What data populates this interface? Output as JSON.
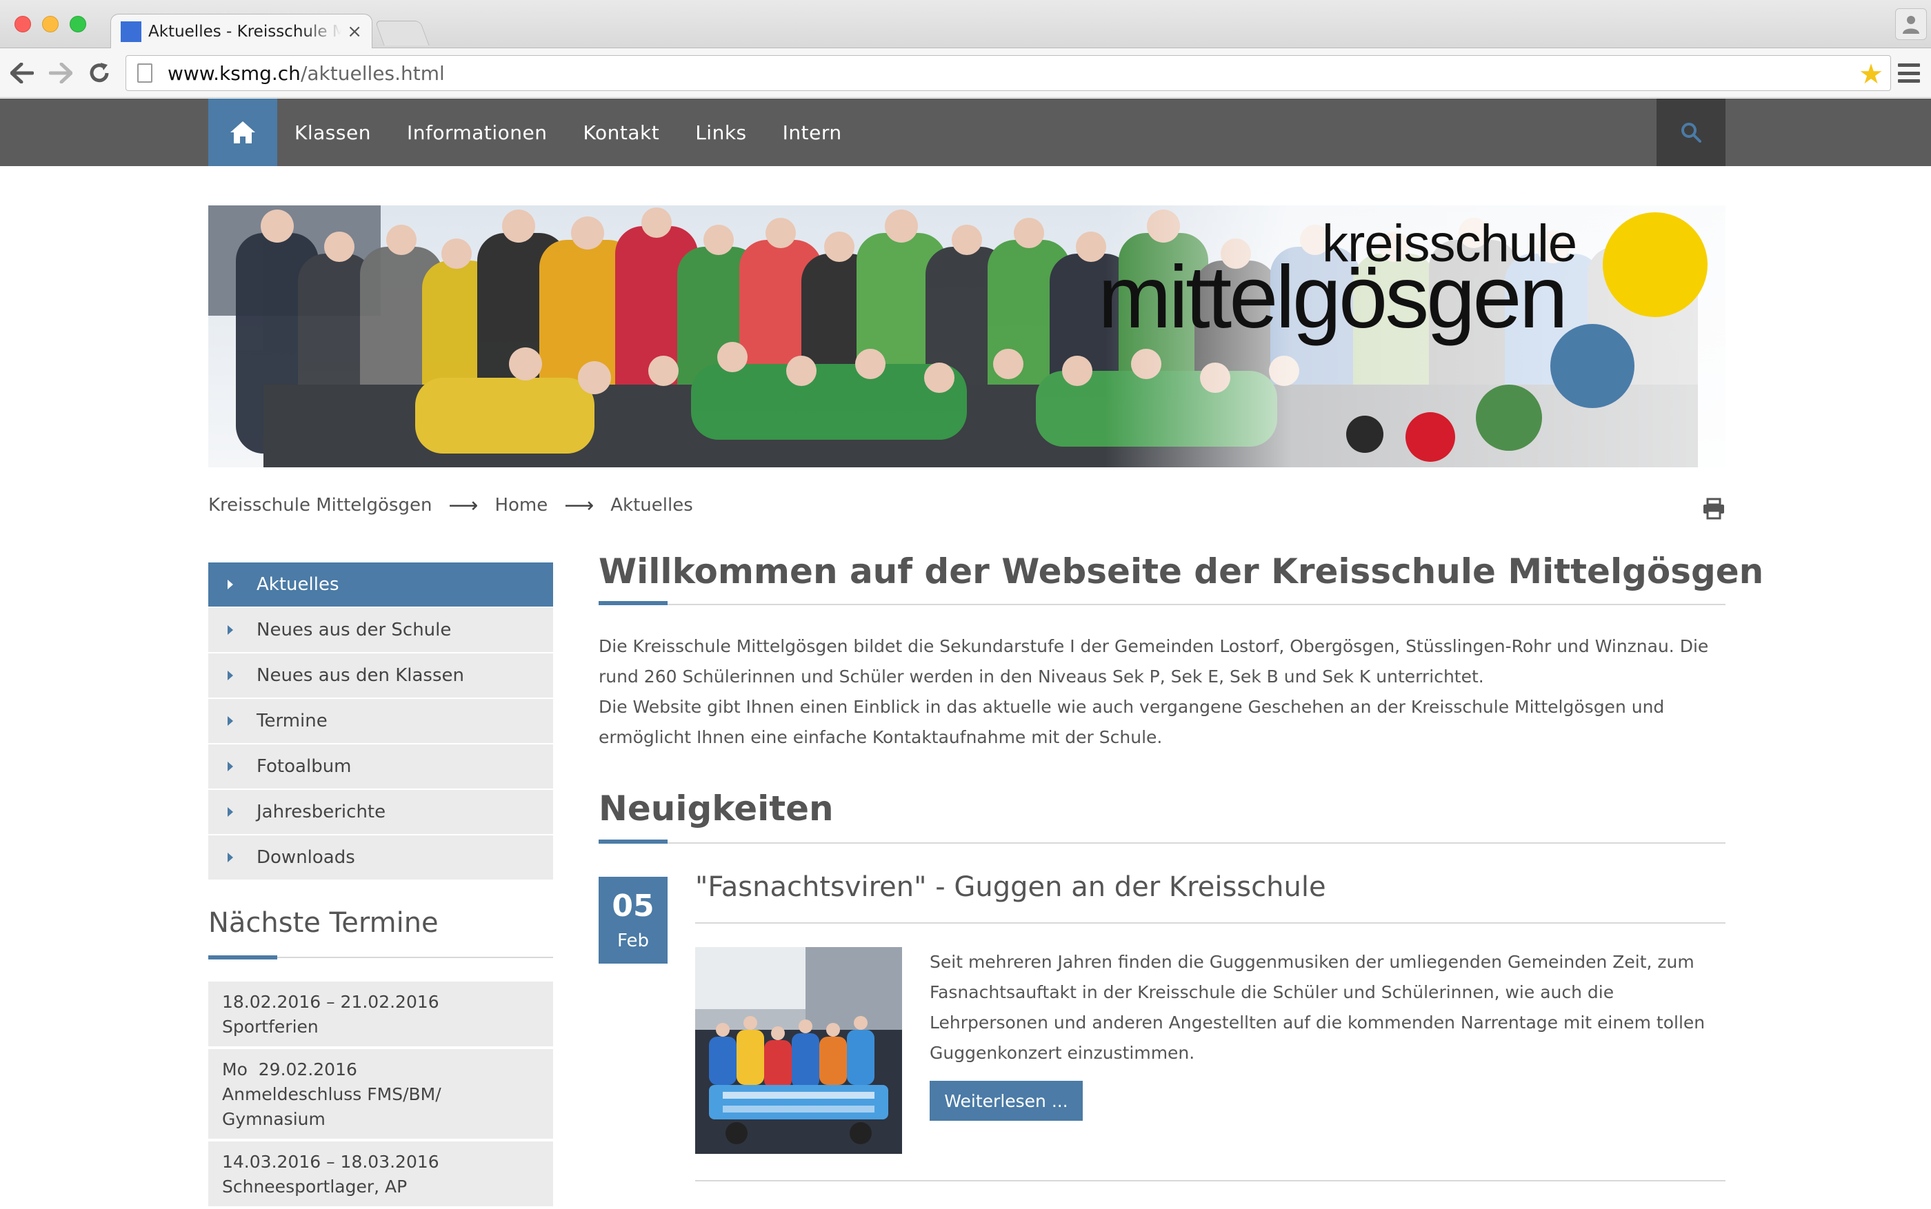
{
  "browser": {
    "tab_title": "Aktuelles - Kreisschule Mittelgösgen",
    "tab_close": "×",
    "url_domain": "www.ksmg.ch",
    "url_path": "/aktuelles.html"
  },
  "nav": {
    "items": [
      "Klassen",
      "Informationen",
      "Kontakt",
      "Links",
      "Intern"
    ]
  },
  "banner": {
    "logo_line1": "kreisschule",
    "logo_line2": "mittelgösgen"
  },
  "breadcrumb": [
    "Kreisschule Mittelgösgen",
    "Home",
    "Aktuelles"
  ],
  "sidebar": {
    "items": [
      "Aktuelles",
      "Neues aus der Schule",
      "Neues aus den Klassen",
      "Termine",
      "Fotoalbum",
      "Jahresberichte",
      "Downloads"
    ],
    "termine_title": "Nächste Termine",
    "termine": [
      {
        "line1": "18.02.2016 – 21.02.2016",
        "line2": "Sportferien",
        "line3": ""
      },
      {
        "line1": "Mo  29.02.2016",
        "line2": "Anmeldeschluss FMS/BM/",
        "line3": "Gymnasium"
      },
      {
        "line1": "14.03.2016 – 18.03.2016",
        "line2": "Schneesportlager, AP",
        "line3": ""
      }
    ]
  },
  "main": {
    "title": "Willkommen auf der Webseite der Kreisschule Mittelgösgen",
    "intro_p1": "Die Kreisschule Mittelgösgen bildet die Sekundarstufe I der Gemeinden Lostorf, Obergösgen, Stüsslingen-Rohr und Winznau. Die rund 260 Schülerinnen und Schüler werden in den Niveaus Sek P, Sek E, Sek B und Sek K unterrichtet.",
    "intro_p2": "Die Website gibt Ihnen einen Einblick in das aktuelle wie auch vergangene Geschehen an der Kreisschule Mittelgösgen und ermöglicht Ihnen eine einfache Kontaktaufnahme mit der Schule.",
    "news_heading": "Neuigkeiten",
    "news": {
      "day": "05",
      "month": "Feb",
      "title": "\"Fasnachtsviren\" - Guggen an der Kreisschule",
      "text": "Seit mehreren Jahren finden die Guggenmusiken der umliegenden Gemeinden Zeit, zum Fasnachtsauftakt in der Kreisschule die Schüler und Schülerinnen, wie auch die Lehrpersonen und anderen Angestellten auf die kommenden Narrentage mit einem tollen Guggenkonzert einzustimmen.",
      "readmore": "Weiterlesen ..."
    }
  },
  "colors": {
    "accent": "#4b7ba6",
    "nav_bg": "#5c5c5c",
    "dot_yellow": "#f7d000",
    "dot_blue": "#4a7ca8",
    "dot_green": "#4e8e4c",
    "dot_red": "#d41c2c",
    "dot_dark": "#2a2a2a"
  }
}
